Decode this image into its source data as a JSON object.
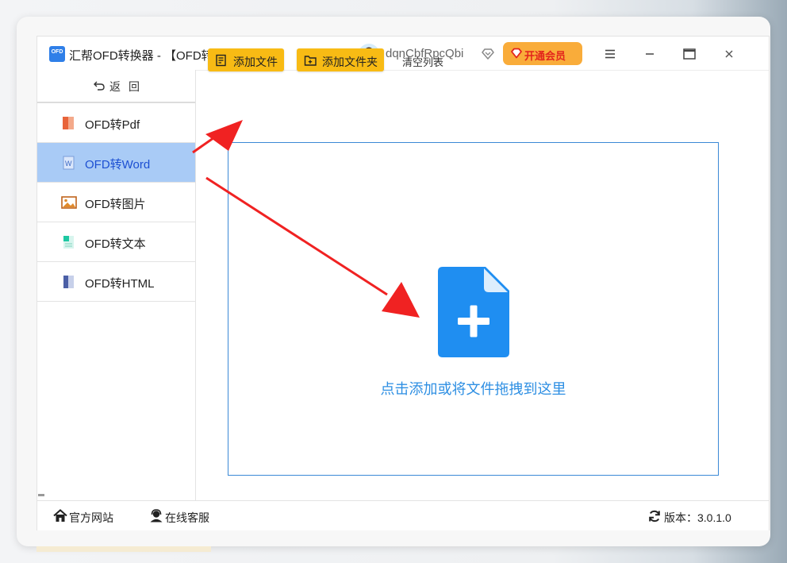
{
  "app": {
    "logo_text": "OFD",
    "title": "汇帮OFD转换器 - 【OFD转文件】",
    "username": "dqnCbfRpcQbi",
    "vip_label": "开通会员"
  },
  "sidebar": {
    "back_label": "返回",
    "items": [
      {
        "label": "OFD转Pdf",
        "icon": "pdf-file-icon",
        "active": false
      },
      {
        "label": "OFD转Word",
        "icon": "word-file-icon",
        "active": true
      },
      {
        "label": "OFD转图片",
        "icon": "image-file-icon",
        "active": false
      },
      {
        "label": "OFD转文本",
        "icon": "text-file-icon",
        "active": false
      },
      {
        "label": "OFD转HTML",
        "icon": "html-file-icon",
        "active": false
      }
    ]
  },
  "toolbar": {
    "add_file_label": "添加文件",
    "add_folder_label": "添加文件夹",
    "clear_list_label": "清空列表"
  },
  "dropzone": {
    "hint": "点击添加或将文件拖拽到这里"
  },
  "footer": {
    "website_label": "官方网站",
    "support_label": "在线客服",
    "version_label": "版本：3.0.1.0"
  },
  "colors": {
    "accent": "#f8bb14",
    "active_nav": "#a9cbf6",
    "dropzone_border": "#3b89d6",
    "file_icon": "#1f8ef1",
    "annotation_arrow": "#f02222",
    "vip_button": "#f9ac3a"
  }
}
